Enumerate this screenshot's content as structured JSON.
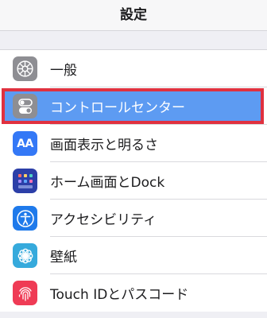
{
  "nav": {
    "title": "設定"
  },
  "rows": [
    {
      "label": "一般",
      "icon": "gear-icon",
      "color": "#8e8e93"
    },
    {
      "label": "コントロールセンター",
      "icon": "toggles-icon",
      "color": "#8e8e93",
      "selected": true
    },
    {
      "label": "画面表示と明るさ",
      "icon": "aa-text-icon",
      "icon_text": "AA",
      "color": "#3478f6"
    },
    {
      "label": "ホーム画面とDock",
      "icon": "app-grid-icon",
      "color": "#2c3fa8"
    },
    {
      "label": "アクセシビリティ",
      "icon": "accessibility-person-icon",
      "color": "#1f7aeb"
    },
    {
      "label": "壁紙",
      "icon": "flower-icon",
      "color": "#36aadc"
    },
    {
      "label": "Touch IDとパスコード",
      "icon": "fingerprint-icon",
      "color": "#ef3b55"
    }
  ],
  "highlight_color": "#e0313f"
}
